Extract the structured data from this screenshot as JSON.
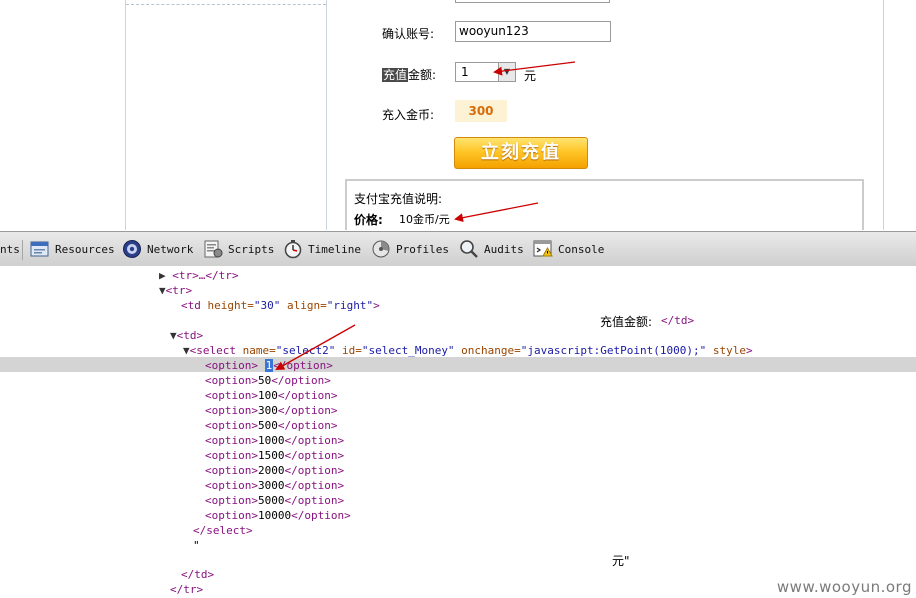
{
  "form": {
    "confirm_account_label": "确认账号:",
    "confirm_account_value": "wooyun123",
    "amount_label_highlight": "充值",
    "amount_label_rest": "金额:",
    "amount_selected": "1",
    "amount_unit": "元",
    "coins_label": "充入金币:",
    "coins_value": "300",
    "recharge_button": "立刻充值"
  },
  "info": {
    "title": "支付宝充值说明:",
    "price_label": "价格:",
    "price_value": "10金币/元"
  },
  "devtools": {
    "tabs": [
      {
        "label": "nts",
        "icon": "elements-icon"
      },
      {
        "label": "Resources",
        "icon": "resources-icon"
      },
      {
        "label": "Network",
        "icon": "network-icon"
      },
      {
        "label": "Scripts",
        "icon": "scripts-icon"
      },
      {
        "label": "Timeline",
        "icon": "timeline-icon"
      },
      {
        "label": "Profiles",
        "icon": "profiles-icon"
      },
      {
        "label": "Audits",
        "icon": "audits-icon"
      },
      {
        "label": "Console",
        "icon": "console-icon"
      }
    ]
  },
  "tree": {
    "tr_collapsed": "<tr>…</tr>",
    "tr_open": "<tr>",
    "td_open_tag": "<td",
    "td_attr1_name": " height=",
    "td_attr1_val": "\"30\"",
    "td_attr2_name": " align=",
    "td_attr2_val": "\"right\"",
    "td_open_close": ">",
    "td_label_text": "充值金额:",
    "td_close": "</td>",
    "td2_open": "<td>",
    "select_open": "<select",
    "select_name_attr": " name=",
    "select_name_val": "\"select2\"",
    "select_id_attr": " id=",
    "select_id_val": "\"select_Money\"",
    "select_onchange_attr": " onchange=",
    "select_onchange_val": "\"javascript:GetPoint(1000);\"",
    "select_style_attr": " style",
    "select_open_close": ">",
    "option_open": "<option>",
    "option_close": "</option>",
    "selected_option_text": "1",
    "options": [
      "50",
      "100",
      "300",
      "500",
      "1000",
      "1500",
      "2000",
      "3000",
      "5000",
      "10000"
    ],
    "select_close": "</select>",
    "quote_text": "\"",
    "yuan_text": "元\"",
    "td2_close": "</td>",
    "tr_close": "</tr>"
  },
  "watermark": "www.wooyun.org",
  "colors": {
    "tag": "#881280",
    "attr": "#994500",
    "value": "#1a1aa6",
    "annotation_arrow": "#cc0000",
    "selection": "#3875d7"
  }
}
